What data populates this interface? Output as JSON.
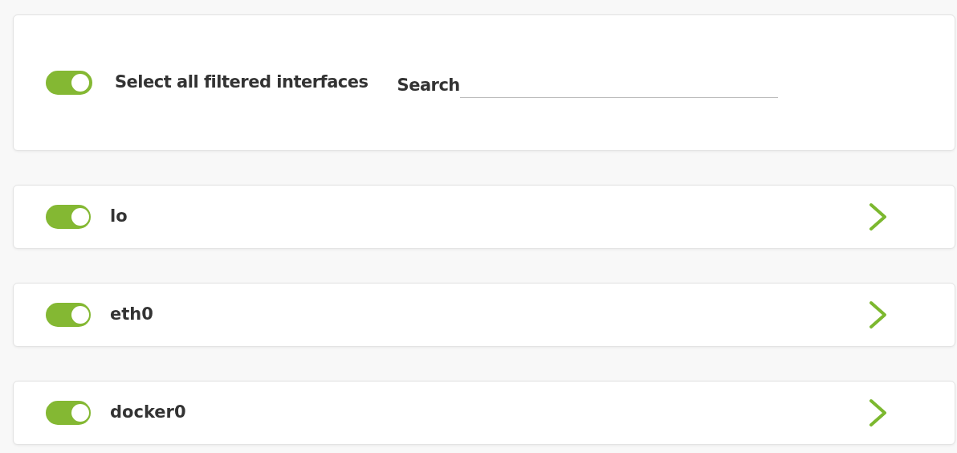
{
  "filter_panel": {
    "select_all": {
      "label": "Select all filtered interfaces",
      "on": true
    },
    "search": {
      "label": "Search"
    }
  },
  "interfaces": [
    {
      "name": "lo",
      "on": true,
      "expanded": false
    },
    {
      "name": "eth0",
      "on": true,
      "expanded": false
    },
    {
      "name": "docker0",
      "on": true,
      "expanded": false
    }
  ]
}
